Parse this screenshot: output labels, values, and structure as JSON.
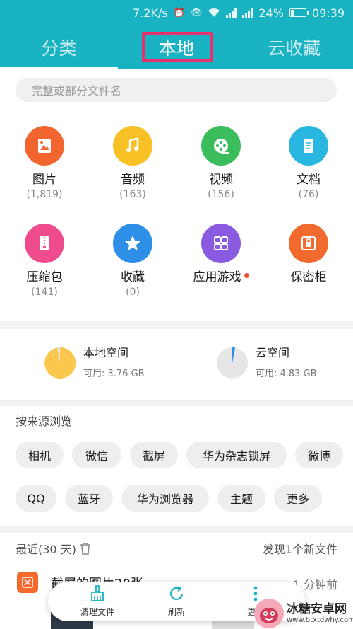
{
  "status_bar": {
    "speed": "7.2K/s",
    "battery": "24%",
    "time": "09:39",
    "net1": "4G",
    "net2": "2G"
  },
  "tabs": [
    {
      "label": "分类",
      "active": false
    },
    {
      "label": "本地",
      "active": true
    },
    {
      "label": "云收藏",
      "active": false
    }
  ],
  "search": {
    "placeholder": "完整或部分文件名"
  },
  "categories": [
    {
      "label": "图片",
      "count": "(1,819)",
      "color": "#f2652e",
      "icon": "image-icon"
    },
    {
      "label": "音频",
      "count": "(163)",
      "color": "#f7c025",
      "icon": "music-icon"
    },
    {
      "label": "视频",
      "count": "(156)",
      "color": "#3cbd5c",
      "icon": "film-reel-icon"
    },
    {
      "label": "文档",
      "count": "(76)",
      "color": "#29b6e0",
      "icon": "document-icon"
    },
    {
      "label": "压缩包",
      "count": "(141)",
      "color": "#ef4c8e",
      "icon": "archive-icon"
    },
    {
      "label": "收藏",
      "count": "(0)",
      "color": "#2e8fe6",
      "icon": "star-icon"
    },
    {
      "label": "应用游戏",
      "count": "",
      "color": "#8a5ae0",
      "icon": "apps-grid-icon"
    },
    {
      "label": "保密柜",
      "count": "",
      "color": "#f26a2e",
      "icon": "safe-icon"
    }
  ],
  "storage": [
    {
      "name": "本地空间",
      "free": "可用: 3.76 GB",
      "color": "#f9c84c",
      "used_fraction": 0.97
    },
    {
      "name": "云空间",
      "free": "可用: 4.83 GB",
      "color": "#2e8fe6",
      "used_fraction": 0.03
    }
  ],
  "sources": {
    "title": "按来源浏览",
    "row1": [
      "相机",
      "微信",
      "截屏",
      "华为杂志锁屏",
      "微博"
    ],
    "row2": [
      "QQ",
      "蓝牙",
      "华为浏览器",
      "主题",
      "更多"
    ]
  },
  "recent": {
    "title": "最近(30 天)",
    "new_files": "发现1个新文件",
    "item_title": "截屏的图片20张",
    "item_time": "1 分钟前"
  },
  "bottom_bar": [
    {
      "label": "清理文件",
      "icon": "broom-icon"
    },
    {
      "label": "刷新",
      "icon": "refresh-icon"
    },
    {
      "label": "更多",
      "icon": "more-vertical-icon"
    }
  ],
  "watermark": {
    "title": "冰糖安卓网",
    "url": "www.btxtdwhy.com"
  },
  "colors": {
    "header": "#19b2c2",
    "highlight": "#e5306b"
  }
}
